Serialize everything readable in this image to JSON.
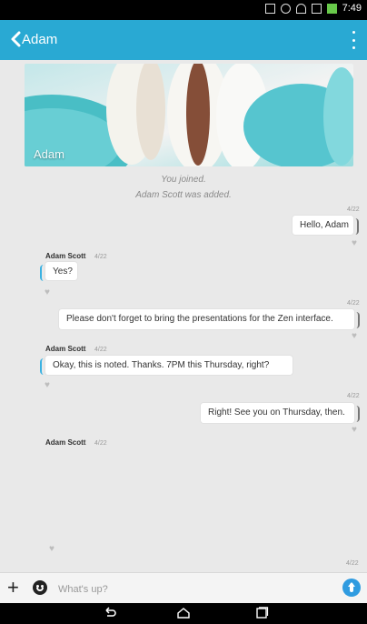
{
  "status_bar": {
    "time": "7:49"
  },
  "app_bar": {
    "title": "Adam"
  },
  "banner": {
    "label": "Adam"
  },
  "system_messages": [
    "You joined.",
    "Adam Scott was added."
  ],
  "messages": [
    {
      "side": "right",
      "date": "4/22",
      "text": "Hello, Adam"
    },
    {
      "side": "left",
      "sender": "Adam Scott",
      "date": "4/22",
      "text": "Yes?"
    },
    {
      "side": "right",
      "date": "4/22",
      "text": "Please don't forget to bring the presentations for the Zen interface."
    },
    {
      "side": "left",
      "sender": "Adam Scott",
      "date": "4/22",
      "text": "Okay, this is noted. Thanks. 7PM this Thursday, right?"
    },
    {
      "side": "right",
      "date": "4/22",
      "text": "Right! See you on Thursday, then."
    },
    {
      "side": "left",
      "sender": "Adam Scott",
      "date": "4/22",
      "text": ""
    }
  ],
  "bottom_date": "4/22",
  "composer": {
    "placeholder": "What's up?"
  },
  "colors": {
    "accent": "#29a9d3",
    "send": "#2f9be0"
  }
}
